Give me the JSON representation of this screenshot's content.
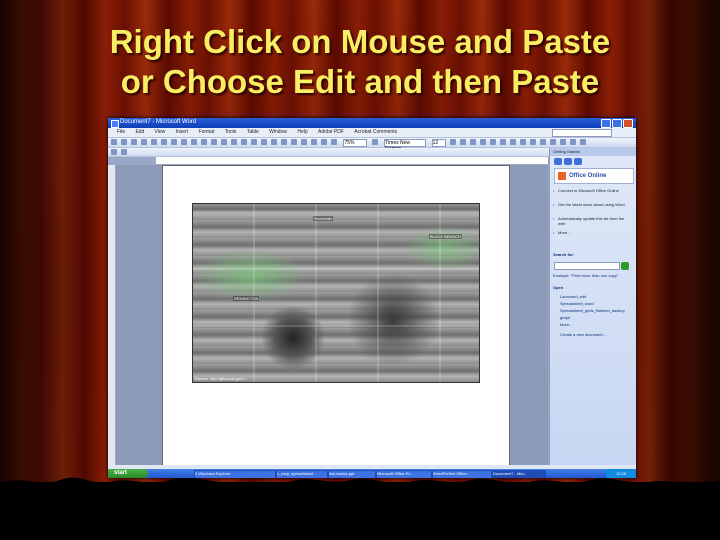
{
  "slide": {
    "title_line1": "Right Click on Mouse and Paste",
    "title_line2": "or Choose Edit and then Paste"
  },
  "word": {
    "window_title": "Document7 - Microsoft Word",
    "menu": [
      "File",
      "Edit",
      "View",
      "Insert",
      "Format",
      "Tools",
      "Table",
      "Window",
      "Help",
      "Adobe PDF",
      "Acrobat Comments"
    ],
    "zoom": "75%",
    "font_name": "Times New Roman",
    "font_size": "12",
    "ask_placeholder": "Type a question for help",
    "map": {
      "labels": [
        "Rochester",
        "REMINGTON",
        "BLACK BRANCH"
      ],
      "caption": "Source: http://gis.usda.gov/..."
    },
    "task_pane": {
      "header": "Getting Started",
      "logo_text": "Office Online",
      "links": [
        "Connect to Microsoft Office Online",
        "Get the latest news about using Word",
        "Automatically update this list from the web",
        "More..."
      ],
      "search_label": "Search for:",
      "example": "Example: \"Print more than one copy\"",
      "open_heading": "Open",
      "documents": [
        "Launched_edit",
        "Spreadsheet_word",
        "Spreadsheet_grids_finished_backup",
        "graph",
        "More..."
      ],
      "create_new": "Create a new document..."
    }
  },
  "taskbar": {
    "start_label": "start",
    "tasks": [
      "3 Windows Explorer",
      "c_map_spreadsheet",
      "link-basics.ppt",
      "Microsoft Office Ex...",
      "WordPerfect Office..",
      "Document7 - Micr.."
    ],
    "clock": "10:28"
  },
  "colors": {
    "title": "#f7ee62",
    "curtain": "#8a1e06"
  }
}
